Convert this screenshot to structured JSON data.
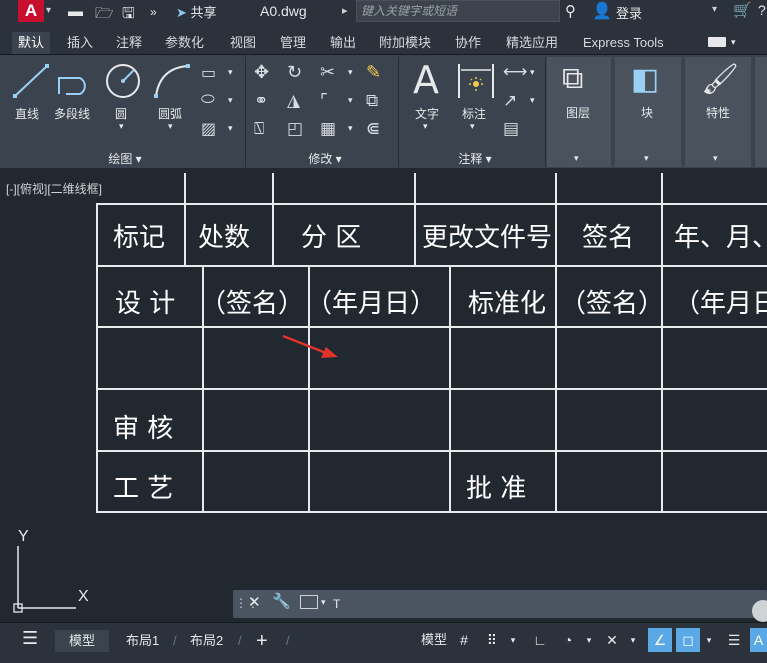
{
  "titlebar": {
    "logo": "A",
    "share_label": "共享",
    "file_name": "A0.dwg",
    "search_placeholder": "键入关键字或短语",
    "login_label": "登录",
    "help_label": "?"
  },
  "ribbon_tabs": [
    "默认",
    "插入",
    "注释",
    "参数化",
    "视图",
    "管理",
    "输出",
    "附加模块",
    "协作",
    "精选应用",
    "Express Tools"
  ],
  "ribbon": {
    "draw": {
      "title": "绘图",
      "line": "直线",
      "polyline": "多段线",
      "circle": "圆",
      "arc": "圆弧"
    },
    "modify": {
      "title": "修改"
    },
    "annotation": {
      "title": "注释",
      "text": "文字",
      "dimension": "标注"
    },
    "layers": "图层",
    "block": "块",
    "properties": "特性"
  },
  "viewport_label": "[-][俯视][二维线框]",
  "table": {
    "row1": [
      "标记",
      "处数",
      "分  区",
      "更改文件号",
      "签名",
      "年、月、"
    ],
    "row2": [
      "设  计",
      "（签名）",
      "（年月日）",
      "标准化",
      "（签名）",
      "（年月日"
    ],
    "row4": [
      "审  核"
    ],
    "row5": [
      "工  艺",
      "批  准"
    ]
  },
  "ucs": {
    "y_label": "Y",
    "x_label": "X"
  },
  "command_line": {
    "value": "T"
  },
  "layout_tabs": [
    "模型",
    "布局1",
    "布局2"
  ],
  "status": {
    "model_label": "模型"
  },
  "colors": {
    "background": "#212830",
    "ribbon": "#3b444e",
    "logo": "#c8102e",
    "accent": "#5aa9e6",
    "arrow": "#e0332b"
  }
}
